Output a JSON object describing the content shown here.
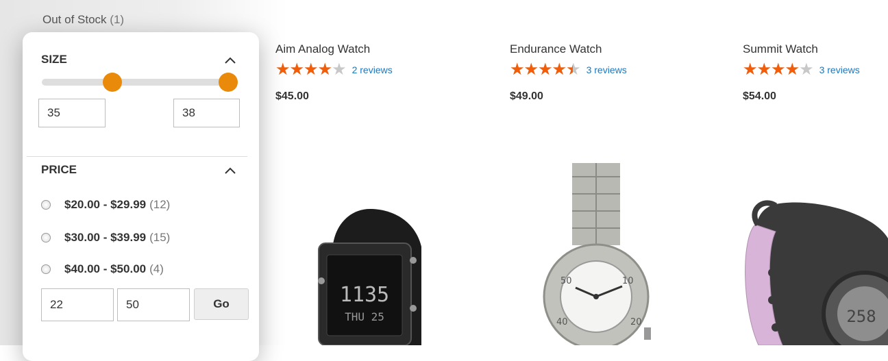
{
  "filters": {
    "out_of_stock_label": "Out of Stock",
    "out_of_stock_count": "(1)",
    "size": {
      "title": "SIZE",
      "min_value": "35",
      "max_value": "38",
      "range_low_fraction": 0.38,
      "range_high_fraction": 1.0
    },
    "price": {
      "title": "PRICE",
      "options": [
        {
          "range": "$20.00 - $29.99",
          "count": "(12)"
        },
        {
          "range": "$30.00 - $39.99",
          "count": "(15)"
        },
        {
          "range": "$40.00 - $50.00",
          "count": "(4)"
        }
      ],
      "min_value": "22",
      "max_value": "50",
      "go_label": "Go"
    }
  },
  "products": [
    {
      "name": "Aim Analog Watch",
      "rating": 4,
      "reviews": "2 reviews",
      "price": "$45.00"
    },
    {
      "name": "Endurance Watch",
      "rating": 4.5,
      "reviews": "3 reviews",
      "price": "$49.00"
    },
    {
      "name": "Summit Watch",
      "rating": 4,
      "reviews": "3 reviews",
      "price": "$54.00"
    }
  ],
  "colors": {
    "accent": "#e98a0b",
    "star": "#f15d09",
    "link": "#1979c3"
  }
}
